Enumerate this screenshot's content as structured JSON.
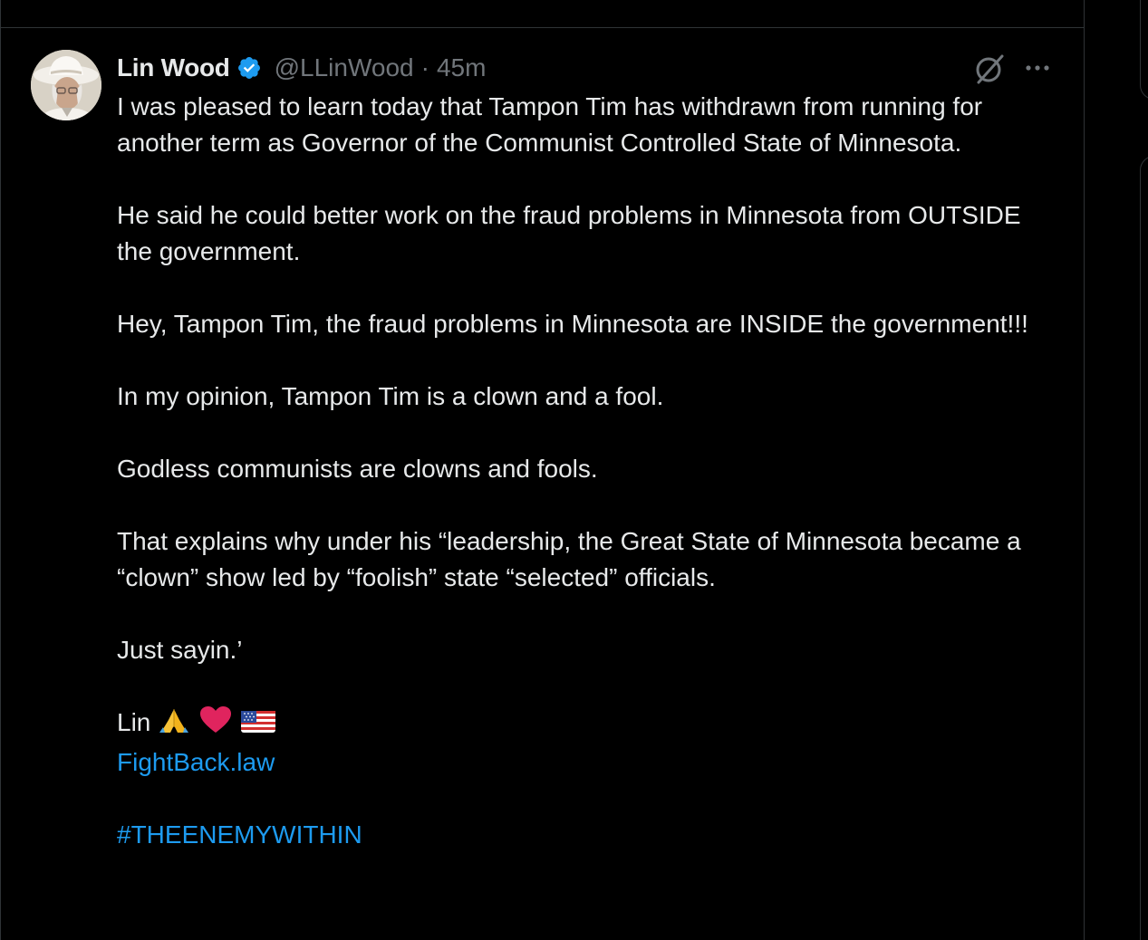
{
  "colors": {
    "background": "#000000",
    "text_primary": "#e7e9ea",
    "text_secondary": "#71767b",
    "accent_link": "#1d9bf0",
    "verified_badge": "#1d9bf0",
    "border": "#2f3336"
  },
  "tweet": {
    "author": {
      "display_name": "Lin Wood",
      "handle": "@LLinWood",
      "verified": true,
      "avatar_icon": "profile-avatar"
    },
    "separator": "·",
    "time": "45m",
    "actions": {
      "grok_icon": "grok-slash-icon",
      "more_icon": "more-horizontal-icon"
    },
    "paragraphs": [
      "I was pleased to learn today that Tampon Tim has withdrawn from running for another term as Governor of the Communist Controlled State of Minnesota.",
      "He said he could better work on the fraud problems in Minnesota from OUTSIDE the government.",
      "Hey, Tampon Tim, the fraud problems in Minnesota are INSIDE the government!!!",
      "In my opinion, Tampon Tim is a clown and a fool.",
      "Godless communists are clowns and fools.",
      "That explains why under his “leadership, the Great State of Minnesota became a “clown” show led by “foolish” state “selected” officials.",
      "Just sayin.’"
    ],
    "signature": "Lin",
    "signature_emojis": [
      "folded-hands-emoji",
      "red-heart-emoji",
      "us-flag-emoji"
    ],
    "link_text": "FightBack.law",
    "hashtag": "#THEENEMYWITHIN"
  }
}
